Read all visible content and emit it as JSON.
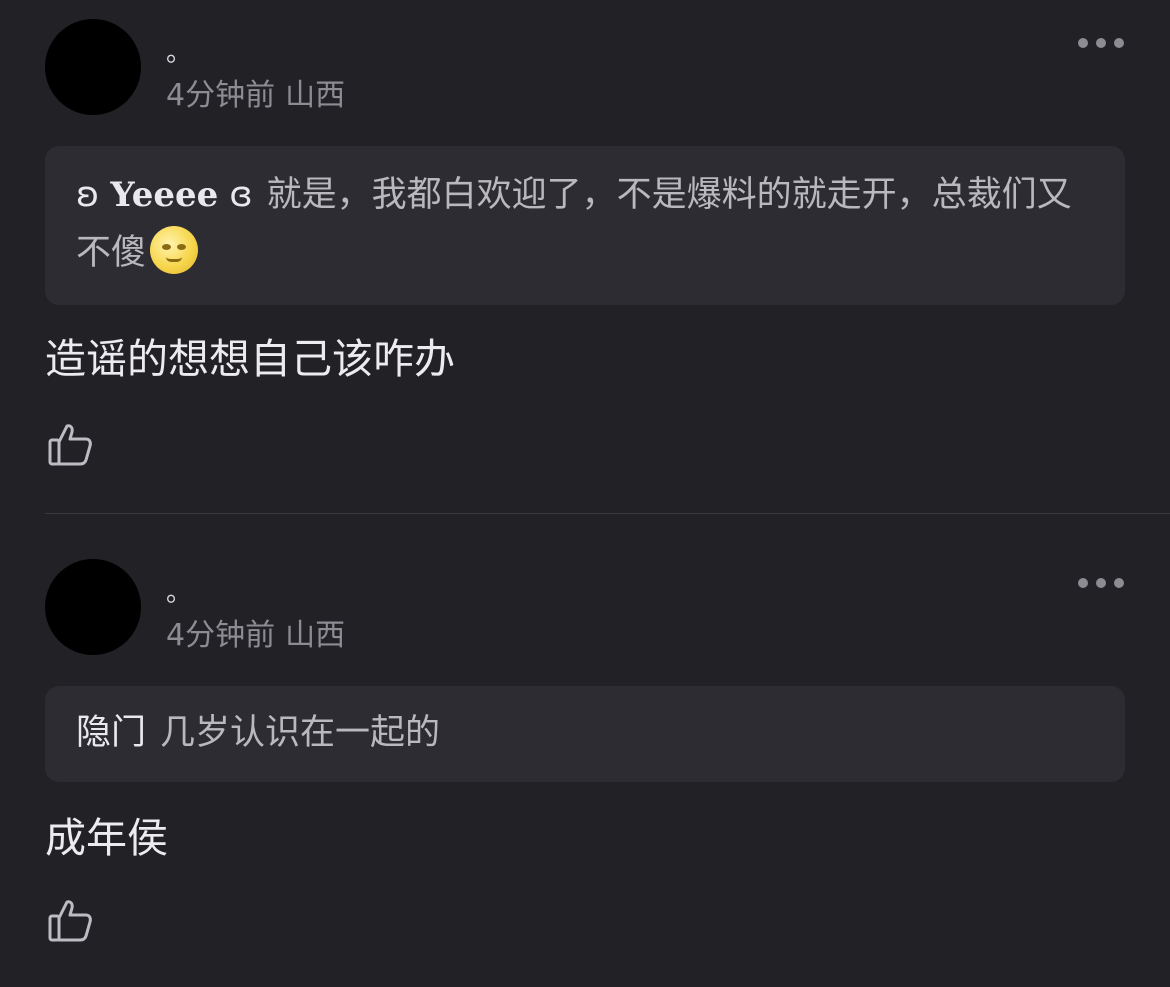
{
  "comments": [
    {
      "username": "。",
      "time": "4分钟前",
      "location": "山西",
      "quote": {
        "author_prefix": "ʚ",
        "author_name": "Yeeee",
        "author_suffix": "ɞ",
        "text": "就是，我都白欢迎了，不是爆料的就走开，总裁们又不傻",
        "emoji": "moon-face-emoji"
      },
      "text": "造谣的想想自己该咋办"
    },
    {
      "username": "。",
      "time": "4分钟前",
      "location": "山西",
      "quote": {
        "author_name": "隐门",
        "text": "几岁认识在一起的"
      },
      "text": "成年侯"
    }
  ],
  "icons": {
    "more": "more-dots-icon",
    "like": "thumbs-up-icon"
  },
  "colors": {
    "background": "#222126",
    "card": "#2d2c32",
    "muted": "#8d8c93",
    "text": "#ecebf0"
  }
}
